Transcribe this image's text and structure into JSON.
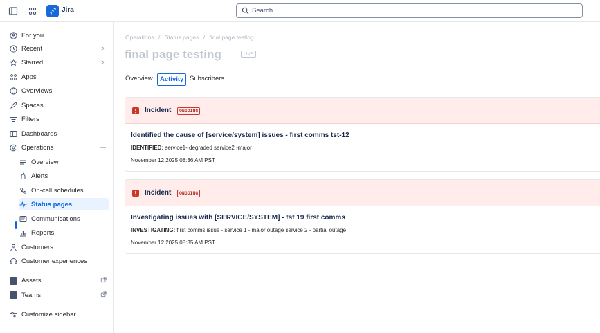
{
  "topbar": {
    "brand": "Jira",
    "search_placeholder": "Search"
  },
  "sidebar": {
    "items": [
      {
        "label": "For you"
      },
      {
        "label": "Recent",
        "right": ">"
      },
      {
        "label": "Starred",
        "right": ">"
      },
      {
        "label": "Apps"
      },
      {
        "label": "Overviews"
      },
      {
        "label": "Spaces"
      },
      {
        "label": "Filters"
      },
      {
        "label": "Dashboards"
      },
      {
        "label": "Operations",
        "right": "···"
      },
      {
        "label": "Overview"
      },
      {
        "label": "Alerts"
      },
      {
        "label": "On-call schedules"
      },
      {
        "label": "Status pages"
      },
      {
        "label": "Communications"
      },
      {
        "label": "Reports"
      },
      {
        "label": "Customers"
      },
      {
        "label": "Customer experiences"
      },
      {
        "label": "Assets"
      },
      {
        "label": "Teams"
      },
      {
        "label": "Customize sidebar"
      }
    ],
    "active_item": "Status pages"
  },
  "main": {
    "breadcrumb": [
      "Operations",
      "/",
      "Status pages",
      "/",
      "final page testing"
    ],
    "title": "final page testing",
    "badge": "LIVE",
    "tabs": [
      {
        "label": "Overview"
      },
      {
        "label": "Activity"
      },
      {
        "label": "Subscribers"
      }
    ],
    "active_tab": "Activity",
    "incidents": [
      {
        "type_label": "Incident",
        "state": "ONGOING",
        "title": "Identified the cause of [service/system] issues - first comms tst-12",
        "status_key": "IDENTIFIED:",
        "status_text": "service1- degraded service2 -major",
        "time": "November 12 2025 08:36 AM PST"
      },
      {
        "type_label": "Incident",
        "state": "ONGOING",
        "title": "Investigating issues with [SERVICE/SYSTEM] - tst 19 first comms",
        "status_key": "INVESTIGATING:",
        "status_text": "first comms issue - service 1 - major outage service 2 - partial outage",
        "time": "November 12 2025 08:35 AM PST"
      }
    ]
  },
  "colors": {
    "accent": "#0c66e4",
    "incident_bg": "#ffeceb",
    "incident_red": "#c9372c"
  }
}
